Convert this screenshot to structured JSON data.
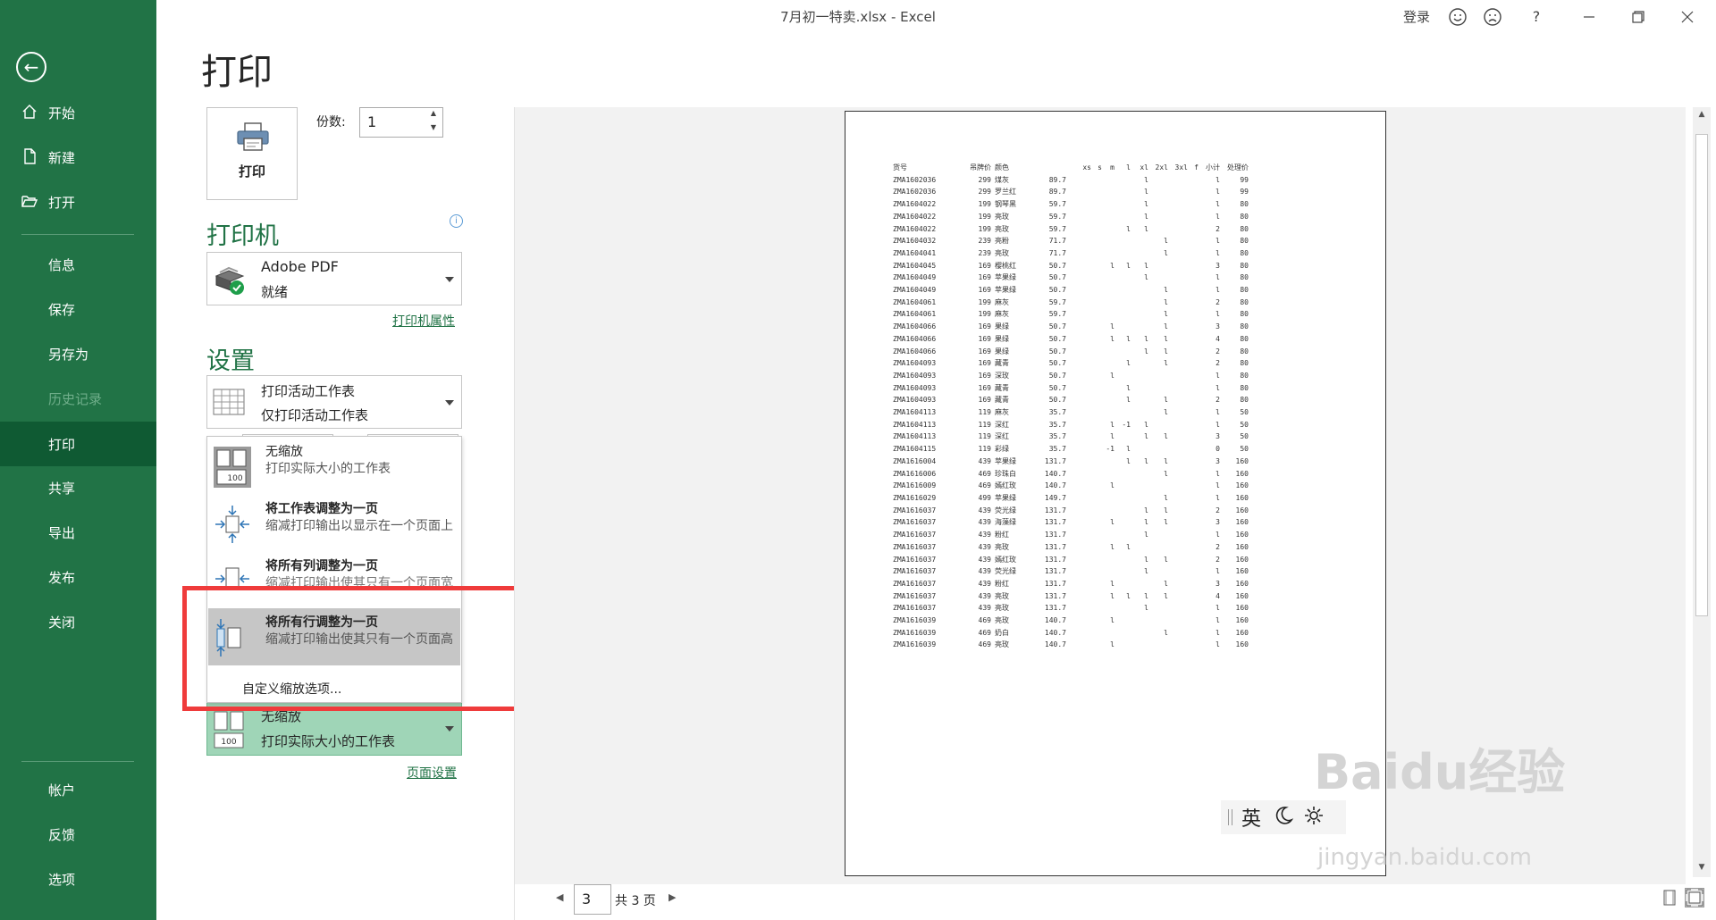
{
  "window": {
    "title": "7月初一特卖.xlsx  -  Excel",
    "signin": "登录",
    "help": "?"
  },
  "sidebar": {
    "items": [
      {
        "label": "开始",
        "icon": "home-icon"
      },
      {
        "label": "新建",
        "icon": "new-document-icon"
      },
      {
        "label": "打开",
        "icon": "open-folder-icon"
      },
      {
        "label": "信息"
      },
      {
        "label": "保存"
      },
      {
        "label": "另存为"
      },
      {
        "label": "历史记录",
        "disabled": true
      },
      {
        "label": "打印",
        "active": true
      },
      {
        "label": "共享"
      },
      {
        "label": "导出"
      },
      {
        "label": "发布"
      },
      {
        "label": "关闭"
      },
      {
        "label": "帐户"
      },
      {
        "label": "反馈"
      },
      {
        "label": "选项"
      }
    ]
  },
  "page": {
    "heading": "打印",
    "print_button_label": "打印",
    "copies_label": "份数:",
    "copies_value": "1"
  },
  "printer": {
    "section_title": "打印机",
    "name": "Adobe PDF",
    "status": "就绪",
    "properties_link": "打印机属性"
  },
  "settings": {
    "section_title": "设置",
    "scope_title": "打印活动工作表",
    "scope_desc": "仅打印活动工作表",
    "scaling_title": "无缩放",
    "scaling_desc": "打印实际大小的工作表",
    "page_setup_link": "页面设置"
  },
  "scaling_menu": {
    "items": [
      {
        "title": "无缩放",
        "desc": "打印实际大小的工作表",
        "icon": "no-scaling-icon"
      },
      {
        "title": "将工作表调整为一页",
        "desc": "缩减打印输出以显示在一个页面上",
        "icon": "fit-sheet-icon"
      },
      {
        "title": "将所有列调整为一页",
        "desc": "缩减打印输出使其只有一个页面宽",
        "icon": "fit-columns-icon"
      },
      {
        "title": "将所有行调整为一页",
        "desc": "缩减打印输出使其只有一个页面高",
        "icon": "fit-rows-icon",
        "selected": true
      }
    ],
    "custom": "自定义缩放选项..."
  },
  "pager": {
    "current": "3",
    "total": "共 3 页"
  },
  "ime": {
    "lang": "英"
  },
  "watermark": {
    "brand": "Baidu经验",
    "url": "jingyan.baidu.com"
  },
  "sheet": {
    "headers": [
      "货号",
      "吊牌价",
      "颜色",
      "",
      "xs",
      "s",
      "m",
      "l",
      "xl",
      "2xl",
      "3xl",
      "f",
      "小计",
      "处理价"
    ],
    "rows": [
      [
        "ZMA1602036",
        "299",
        "煤灰",
        "89.7",
        "",
        "",
        "",
        "",
        "l",
        "",
        "",
        "",
        "l",
        "99"
      ],
      [
        "ZMA1602036",
        "299",
        "罗兰红",
        "89.7",
        "",
        "",
        "",
        "",
        "l",
        "",
        "",
        "",
        "l",
        "99"
      ],
      [
        "ZMA1604022",
        "199",
        "钢琴黑",
        "59.7",
        "",
        "",
        "",
        "",
        "l",
        "",
        "",
        "",
        "l",
        "80"
      ],
      [
        "ZMA1604022",
        "199",
        "亮玫",
        "59.7",
        "",
        "",
        "",
        "",
        "l",
        "",
        "",
        "",
        "l",
        "80"
      ],
      [
        "ZMA1604022",
        "199",
        "亮玫",
        "59.7",
        "",
        "",
        "",
        "l",
        "l",
        "",
        "",
        "",
        "2",
        "80"
      ],
      [
        "ZMA1604032",
        "239",
        "亮粉",
        "71.7",
        "",
        "",
        "",
        "",
        "",
        "l",
        "",
        "",
        "l",
        "80"
      ],
      [
        "ZMA1604041",
        "239",
        "亮玫",
        "71.7",
        "",
        "",
        "",
        "",
        "",
        "l",
        "",
        "",
        "l",
        "80"
      ],
      [
        "ZMA1604045",
        "169",
        "樱桃红",
        "50.7",
        "",
        "",
        "l",
        "l",
        "l",
        "",
        "",
        "",
        "3",
        "80"
      ],
      [
        "ZMA1604049",
        "169",
        "苹果绿",
        "50.7",
        "",
        "",
        "",
        "",
        "l",
        "",
        "",
        "",
        "l",
        "80"
      ],
      [
        "ZMA1604049",
        "169",
        "苹果绿",
        "50.7",
        "",
        "",
        "",
        "",
        "",
        "l",
        "",
        "",
        "l",
        "80"
      ],
      [
        "ZMA1604061",
        "199",
        "麻灰",
        "59.7",
        "",
        "",
        "",
        "",
        "",
        "l",
        "",
        "",
        "2",
        "80"
      ],
      [
        "ZMA1604061",
        "199",
        "麻灰",
        "59.7",
        "",
        "",
        "",
        "",
        "",
        "l",
        "",
        "",
        "l",
        "80"
      ],
      [
        "ZMA1604066",
        "169",
        "果绿",
        "50.7",
        "",
        "",
        "l",
        "",
        "",
        "l",
        "",
        "",
        "3",
        "80"
      ],
      [
        "ZMA1604066",
        "169",
        "果绿",
        "50.7",
        "",
        "",
        "l",
        "l",
        "l",
        "l",
        "",
        "",
        "4",
        "80"
      ],
      [
        "ZMA1604066",
        "169",
        "果绿",
        "50.7",
        "",
        "",
        "",
        "",
        "l",
        "l",
        "",
        "",
        "2",
        "80"
      ],
      [
        "ZMA1604093",
        "169",
        "藏青",
        "50.7",
        "",
        "",
        "",
        "l",
        "",
        "l",
        "",
        "",
        "2",
        "80"
      ],
      [
        "ZMA1604093",
        "169",
        "深玫",
        "50.7",
        "",
        "",
        "l",
        "",
        "",
        "",
        "",
        "",
        "l",
        "80"
      ],
      [
        "ZMA1604093",
        "169",
        "藏青",
        "50.7",
        "",
        "",
        "",
        "l",
        "",
        "",
        "",
        "",
        "l",
        "80"
      ],
      [
        "ZMA1604093",
        "169",
        "藏青",
        "50.7",
        "",
        "",
        "",
        "l",
        "",
        "l",
        "",
        "",
        "2",
        "80"
      ],
      [
        "ZMA1604113",
        "119",
        "麻灰",
        "35.7",
        "",
        "",
        "",
        "",
        "",
        "l",
        "",
        "",
        "l",
        "50"
      ],
      [
        "ZMA1604113",
        "119",
        "深红",
        "35.7",
        "",
        "",
        "l",
        "-1",
        "l",
        "",
        "",
        "",
        "l",
        "50"
      ],
      [
        "ZMA1604113",
        "119",
        "深红",
        "35.7",
        "",
        "",
        "l",
        "",
        "l",
        "l",
        "",
        "",
        "3",
        "50"
      ],
      [
        "ZMA1604115",
        "119",
        "彩绿",
        "35.7",
        "",
        "",
        "-1",
        "l",
        "",
        "",
        "",
        "",
        "0",
        "50"
      ],
      [
        "ZMA1616004",
        "439",
        "苹果绿",
        "131.7",
        "",
        "",
        "",
        "l",
        "l",
        "l",
        "",
        "",
        "3",
        "160"
      ],
      [
        "ZMA1616006",
        "469",
        "珍珠白",
        "140.7",
        "",
        "",
        "",
        "",
        "",
        "l",
        "",
        "",
        "l",
        "160"
      ],
      [
        "ZMA1616009",
        "469",
        "嫣红玫",
        "140.7",
        "",
        "",
        "l",
        "",
        "",
        "",
        "",
        "",
        "l",
        "160"
      ],
      [
        "ZMA1616029",
        "499",
        "苹果绿",
        "149.7",
        "",
        "",
        "",
        "",
        "",
        "l",
        "",
        "",
        "l",
        "160"
      ],
      [
        "ZMA1616037",
        "439",
        "荧光绿",
        "131.7",
        "",
        "",
        "",
        "",
        "l",
        "l",
        "",
        "",
        "2",
        "160"
      ],
      [
        "ZMA1616037",
        "439",
        "海藻绿",
        "131.7",
        "",
        "",
        "l",
        "",
        "l",
        "l",
        "",
        "",
        "3",
        "160"
      ],
      [
        "ZMA1616037",
        "439",
        "粉红",
        "131.7",
        "",
        "",
        "",
        "",
        "l",
        "",
        "",
        "",
        "l",
        "160"
      ],
      [
        "ZMA1616037",
        "439",
        "亮玫",
        "131.7",
        "",
        "",
        "l",
        "l",
        "",
        "",
        "",
        "",
        "2",
        "160"
      ],
      [
        "ZMA1616037",
        "439",
        "嫣红玫",
        "131.7",
        "",
        "",
        "",
        "",
        "l",
        "l",
        "",
        "",
        "2",
        "160"
      ],
      [
        "ZMA1616037",
        "439",
        "荧光绿",
        "131.7",
        "",
        "",
        "",
        "",
        "l",
        "",
        "",
        "",
        "l",
        "160"
      ],
      [
        "ZMA1616037",
        "439",
        "粉红",
        "131.7",
        "",
        "",
        "l",
        "",
        "",
        "l",
        "",
        "",
        "3",
        "160"
      ],
      [
        "ZMA1616037",
        "439",
        "亮玫",
        "131.7",
        "",
        "",
        "l",
        "l",
        "l",
        "l",
        "",
        "",
        "4",
        "160"
      ],
      [
        "ZMA1616037",
        "439",
        "亮玫",
        "131.7",
        "",
        "",
        "",
        "",
        "l",
        "",
        "",
        "",
        "l",
        "160"
      ],
      [
        "ZMA1616039",
        "469",
        "亮玫",
        "140.7",
        "",
        "",
        "l",
        "",
        "",
        "",
        "",
        "",
        "l",
        "160"
      ],
      [
        "ZMA1616039",
        "469",
        "奶白",
        "140.7",
        "",
        "",
        "",
        "",
        "",
        "l",
        "",
        "",
        "l",
        "160"
      ],
      [
        "ZMA1616039",
        "469",
        "亮玫",
        "140.7",
        "",
        "",
        "l",
        "",
        "",
        "",
        "",
        "",
        "l",
        "160"
      ]
    ]
  },
  "colors": {
    "brand_green": "#217346",
    "active_nav": "#0f5a33",
    "highlight_red": "#ef3b3b",
    "selected_dropdown": "#9fd5b7"
  }
}
